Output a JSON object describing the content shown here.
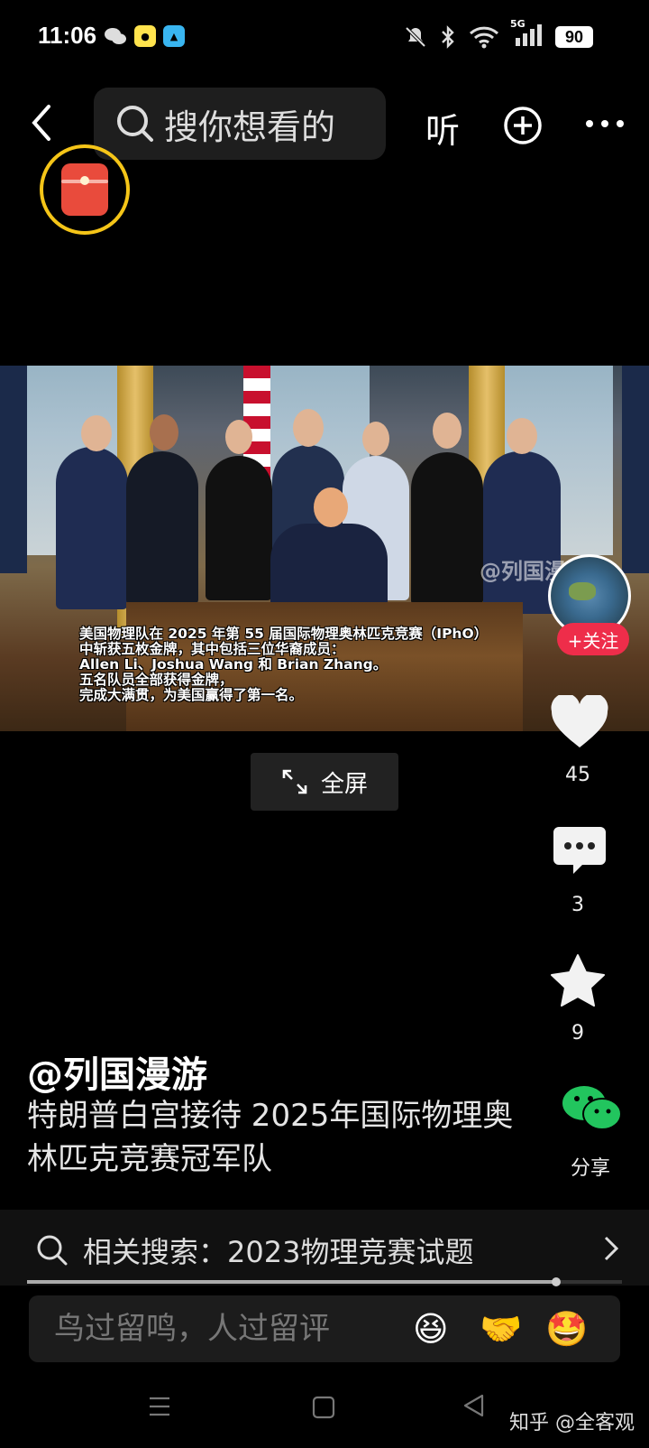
{
  "status_bar": {
    "time": "11:06",
    "network": "5G",
    "battery": "90",
    "app_icons": [
      "chat-bubbles-icon",
      "yellow-app-icon",
      "blue-app-icon"
    ]
  },
  "top_bar": {
    "search_placeholder": "搜你想看的",
    "listen_label": "听"
  },
  "media": {
    "watermark": "@列国漫游",
    "caption": "美国物理队在 2025 年第 55 届国际物理奥林匹克竞赛（IPhO）\n中斩获五枚金牌，其中包括三位华裔成员：\nAllen Li、Joshua Wang 和 Brian Zhang。\n五名队员全部获得金牌，\n完成大满贯，为美国赢得了第一名。",
    "fullscreen_label": "全屏"
  },
  "rail": {
    "follow_label": "+关注",
    "likes": "45",
    "comments": "3",
    "favorites": "9",
    "share_label": "分享"
  },
  "post": {
    "author": "@列国漫游",
    "description": "特朗普白宫接待 2025年国际物理奥林匹克竞赛冠军队"
  },
  "related_search": {
    "label": "相关搜索：2023物理竞赛试题",
    "progress": 0.89
  },
  "comment": {
    "placeholder": "鸟过留鸣，人过留评",
    "emojis": [
      "😆",
      "🤝",
      "🤩"
    ]
  },
  "footer": {
    "watermark": "知乎 @全客观"
  },
  "colors": {
    "follow": "#ee2d4a",
    "envelope_ring": "#f5c518",
    "wechat_green": "#22c55e"
  }
}
